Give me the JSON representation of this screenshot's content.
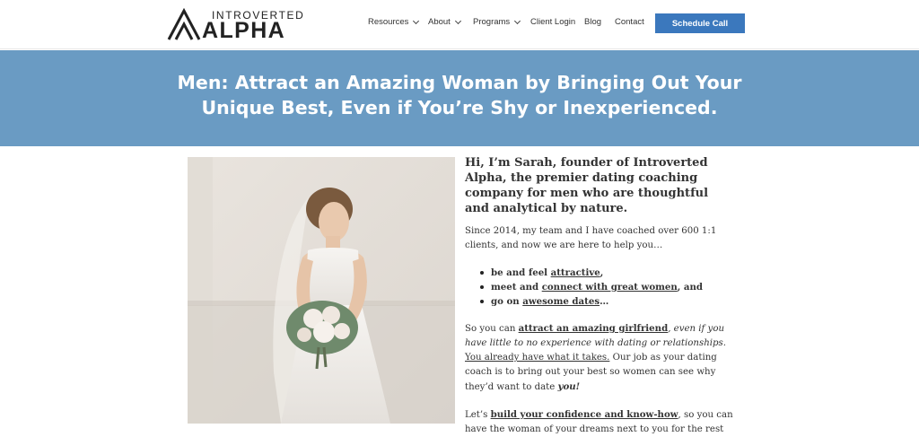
{
  "brand": {
    "logo_top": "INTROVERTED",
    "logo_bottom": "ALPHA",
    "logo_icon": "chevron-mountain-icon"
  },
  "nav": {
    "items": [
      {
        "label": "Resources",
        "dropdown": true
      },
      {
        "label": "About",
        "dropdown": true
      },
      {
        "label": "Programs",
        "dropdown": true
      },
      {
        "label": "Client Login",
        "dropdown": false
      },
      {
        "label": "Blog",
        "dropdown": false
      },
      {
        "label": "Contact",
        "dropdown": false
      }
    ],
    "cta_label": "Schedule Call"
  },
  "hero": {
    "line1": "Men: Attract an Amazing Woman by Bringing Out Your",
    "line2": "Unique Best, Even if You’re Shy or Inexperienced."
  },
  "content": {
    "intro": "Hi, I’m Sarah, founder of Introverted Alpha, the premier dating coaching company for men who are thoughtful and analytical by nature.",
    "para1": "Since 2014, my team and I have coached over 600 1:1 clients, and now we are here to help you…",
    "bullets": [
      {
        "pre": "be and feel ",
        "link": "attractive",
        "post": ","
      },
      {
        "pre": "meet and ",
        "link": "connect with great women",
        "post": ", and"
      },
      {
        "pre": "go on ",
        "link": "awesome dates",
        "post": "…"
      }
    ],
    "para2": {
      "pre": "So you can ",
      "link": "attract an amazing girlfriend",
      "em": ", even if you have little to no experience with dating or relationships.",
      "gap": " ",
      "underline": "You already have what it takes.",
      "mid": " Our job as your dating coach is to bring out your best so women can see why they’d want to date ",
      "end_em": "you!"
    },
    "para3": {
      "pre": "Let’s ",
      "link": "build your confidence and know-how",
      "post": ", so you can have the woman of your dreams next to you for the rest of your life."
    }
  },
  "colors": {
    "hero_bg": "#6a9bc3",
    "cta_bg": "#3b78bd"
  }
}
